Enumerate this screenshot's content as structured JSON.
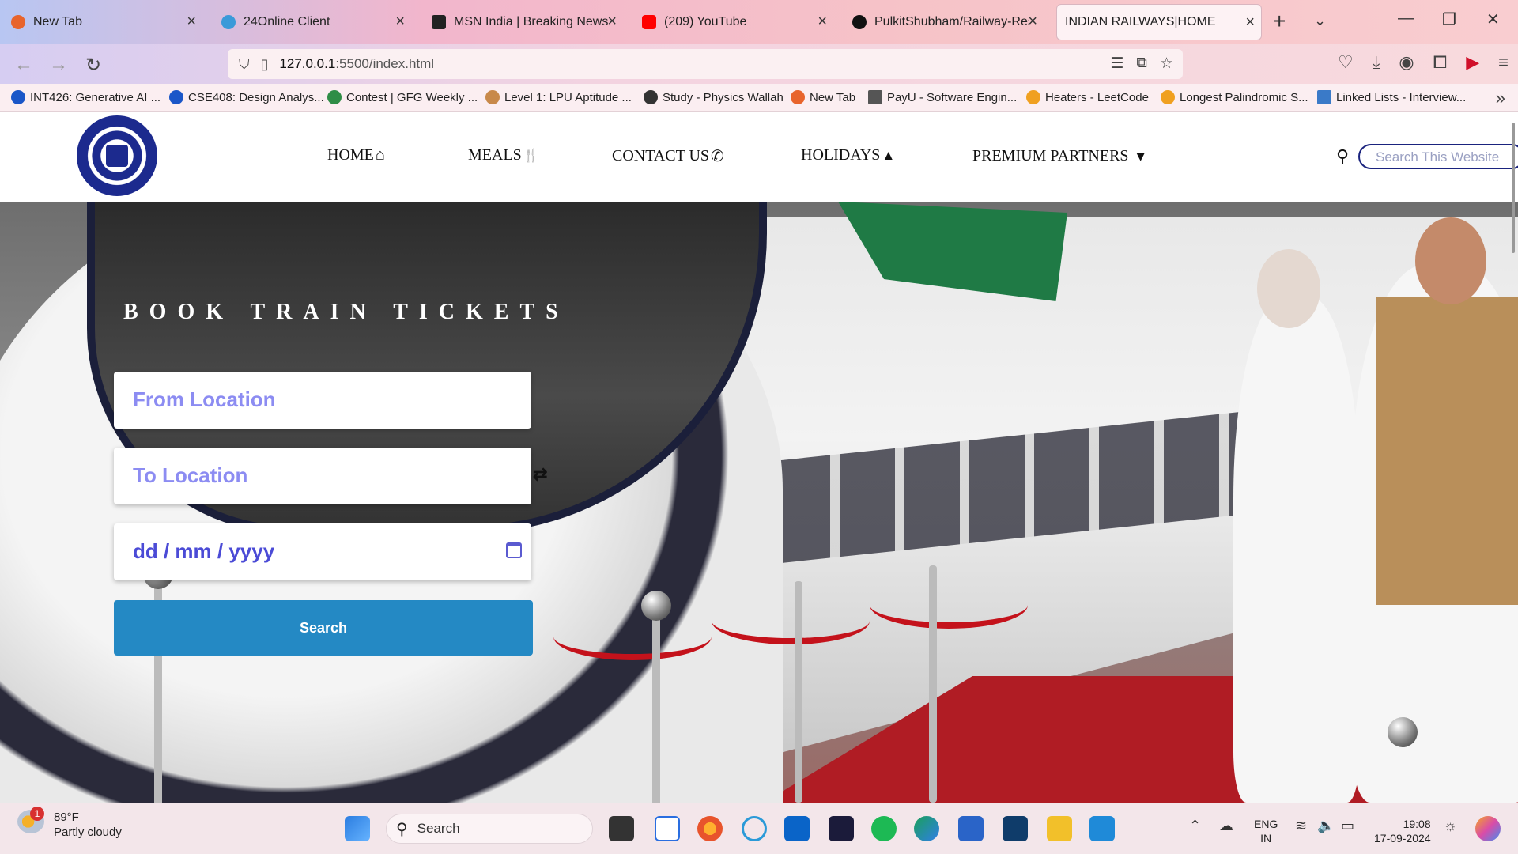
{
  "browser": {
    "tabs": [
      {
        "title": "New Tab",
        "color": "#e8642c"
      },
      {
        "title": "24Online Client",
        "color": "#3a9ad9"
      },
      {
        "title": "MSN India | Breaking News, E",
        "color": "#222222"
      },
      {
        "title": "(209) YouTube",
        "color": "#ff0000"
      },
      {
        "title": "PulkitShubham/Railway-Rese",
        "color": "#111111"
      },
      {
        "title": "INDIAN RAILWAYS|HOME",
        "color": "#ffffff"
      }
    ],
    "url_host": "127.0.0.1",
    "url_rest": ":5500/index.html",
    "bookmarks": [
      {
        "label": "INT426: Generative AI ...",
        "color": "#1a56c8"
      },
      {
        "label": "CSE408: Design Analys...",
        "color": "#1a56c8"
      },
      {
        "label": "Contest | GFG Weekly ...",
        "color": "#2f8d46"
      },
      {
        "label": "Level 1: LPU Aptitude ...",
        "color": "#c8894a"
      },
      {
        "label": "Study - Physics Wallah",
        "color": "#333333"
      },
      {
        "label": "New Tab",
        "color": "#e8642c"
      },
      {
        "label": "PayU - Software Engin...",
        "color": "#555555"
      },
      {
        "label": "Heaters - LeetCode",
        "color": "#f0a020"
      },
      {
        "label": "Longest Palindromic S...",
        "color": "#f0a020"
      },
      {
        "label": "Linked Lists - Interview...",
        "color": "#3a7ac8"
      }
    ]
  },
  "site": {
    "menu": [
      {
        "label": "HOME",
        "icon": "home-icon",
        "glyph": "⌂"
      },
      {
        "label": "MEALS",
        "icon": "fork-knife-icon",
        "glyph": "🍴"
      },
      {
        "label": "CONTACT US",
        "icon": "phone-icon",
        "glyph": "✆"
      },
      {
        "label": "HOLIDAYS",
        "icon": "umbrella-icon",
        "glyph": "▲"
      },
      {
        "label": "PREMIUM PARTNERS",
        "icon": "caret-down-icon",
        "glyph": "▾"
      }
    ],
    "search_placeholder": "Search This Website",
    "hero_title": "BOOK TRAIN TICKETS",
    "from_placeholder": "From Location",
    "to_placeholder": "To Location",
    "date_placeholder": "dd / mm / yyyy",
    "search_button": "Search"
  },
  "taskbar": {
    "weather_temp": "89°F",
    "weather_desc": "Partly cloudy",
    "weather_badge": "1",
    "search_label": "Search",
    "lang_line1": "ENG",
    "lang_line2": "IN",
    "time": "19:08",
    "date": "17-09-2024"
  }
}
